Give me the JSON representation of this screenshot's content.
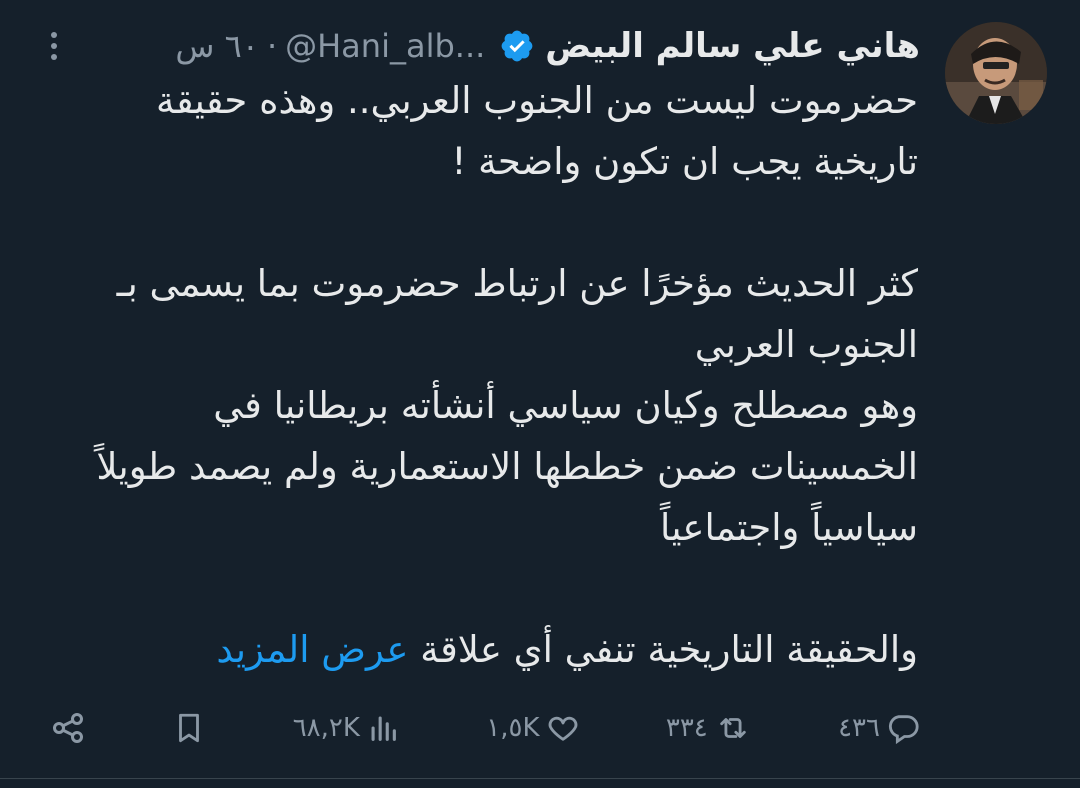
{
  "tweet": {
    "author_name": "هاني علي سالم البيض",
    "author_handle": "@Hani_alb...",
    "separator": "·",
    "time": "٦٠ س",
    "body_lines": [
      "حضرموت ليست من الجنوب العربي.. وهذه حقيقة",
      "تاريخية يجب ان تكون واضحة !",
      "",
      "كثر الحديث مؤخرًا عن ارتباط حضرموت بما يسمى بـ",
      "الجنوب العربي",
      "وهو مصطلح وكيان سياسي أنشأته بريطانيا في",
      "الخمسينات ضمن خططها الاستعمارية ولم يصمد طويلاً",
      "سياسياً واجتماعياً",
      ""
    ],
    "last_line_text": "والحقيقة التاريخية تنفي أي علاقة",
    "show_more_label": "عرض المزيد"
  },
  "actions": {
    "replies": "٤٣٦",
    "retweets": "٣٣٤",
    "likes": "١,٥K",
    "views": "٦٨,٢K"
  },
  "colors": {
    "background": "#15202b",
    "text": "#e7e9ea",
    "muted": "#8b98a5",
    "accent": "#1d9bf0"
  },
  "icons": [
    "avatar",
    "verified-badge-icon",
    "more-options-icon",
    "reply-icon",
    "retweet-icon",
    "like-icon",
    "views-icon",
    "bookmark-icon",
    "share-icon"
  ]
}
